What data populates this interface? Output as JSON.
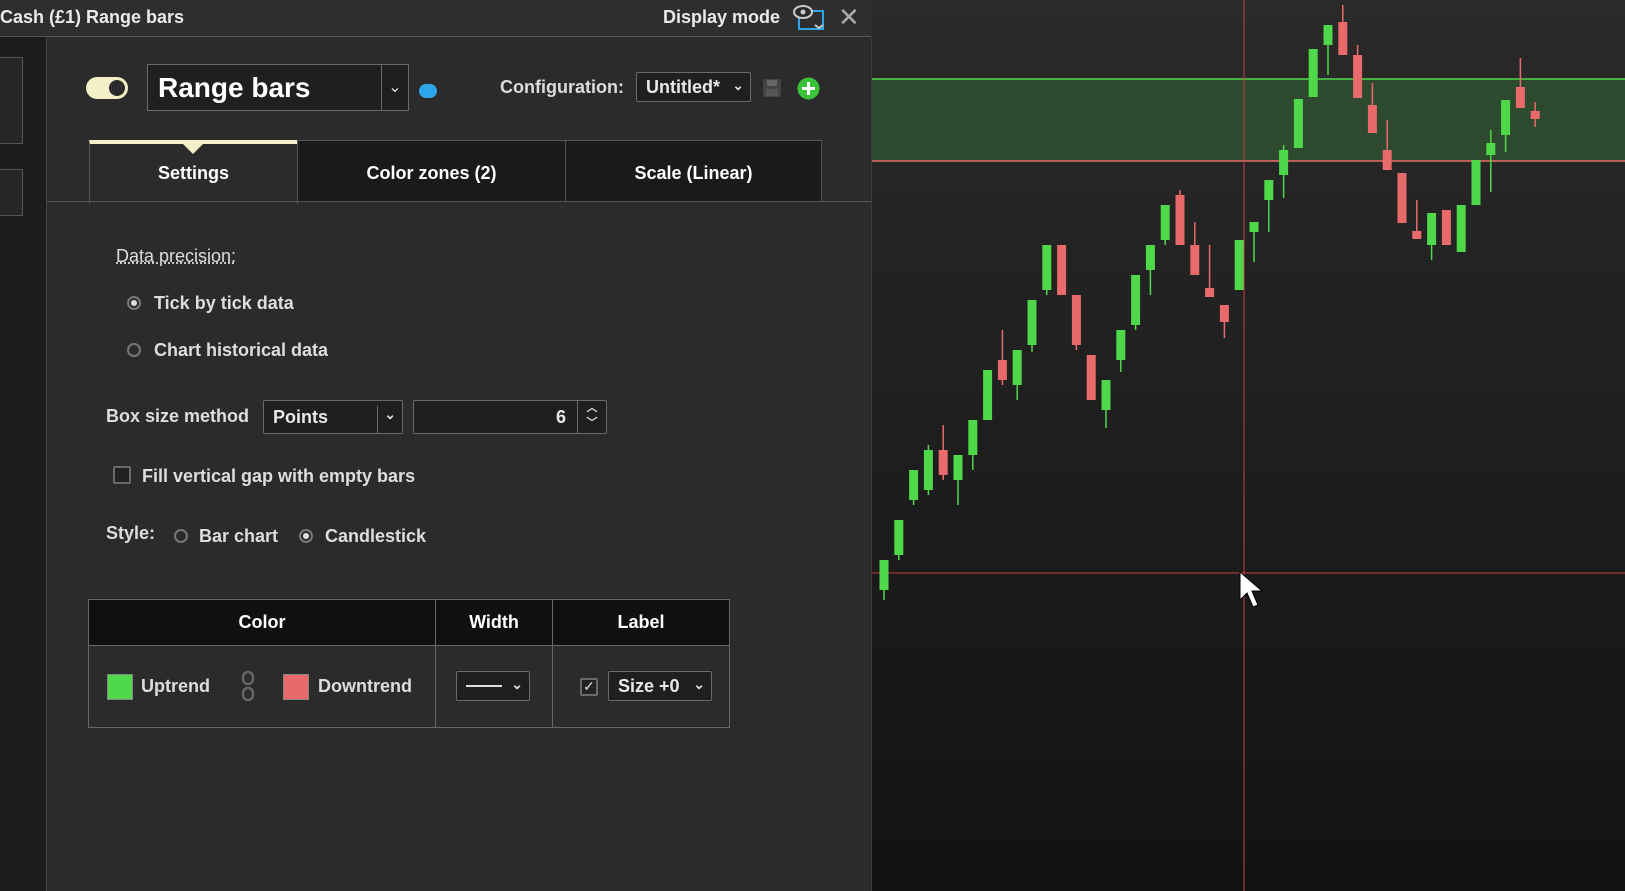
{
  "window": {
    "title": "Cash (£1) Range bars",
    "display_mode_label": "Display mode"
  },
  "indicator": {
    "enabled": true,
    "name": "Range bars"
  },
  "configuration": {
    "label": "Configuration:",
    "value": "Untitled*"
  },
  "tabs": [
    {
      "label": "Settings",
      "active": true
    },
    {
      "label": "Color zones (2)",
      "active": false
    },
    {
      "label": "Scale (Linear)",
      "active": false
    }
  ],
  "settings": {
    "data_precision_label": "Data precision:",
    "precision_options": [
      {
        "label": "Tick by tick data",
        "selected": true
      },
      {
        "label": "Chart historical data",
        "selected": false
      }
    ],
    "box_size_label": "Box size method",
    "box_size_method": "Points",
    "box_size_value": "6",
    "fill_gap_label": "Fill vertical gap with empty bars",
    "fill_gap_checked": false,
    "style_label": "Style:",
    "style_options": [
      {
        "label": "Bar chart",
        "selected": false
      },
      {
        "label": "Candlestick",
        "selected": true
      }
    ]
  },
  "color_table": {
    "headers": [
      "Color",
      "Width",
      "Label"
    ],
    "uptrend_label": "Uptrend",
    "downtrend_label": "Downtrend",
    "uptrend_color": "#4fd84a",
    "downtrend_color": "#e86a6a",
    "label_checked": true,
    "label_size": "Size +0"
  },
  "colors": {
    "accent_toggle": "#f3f0c8",
    "up": "#4fd84a",
    "down": "#e86a6a",
    "zone_fill": "#2e4a2e",
    "crosshair": "#c84040"
  },
  "chart_data": {
    "type": "candlestick",
    "candles": [
      {
        "o": 560,
        "c": 590,
        "h": 560,
        "l": 600,
        "dir": "up"
      },
      {
        "o": 520,
        "c": 555,
        "h": 520,
        "l": 560,
        "dir": "up"
      },
      {
        "o": 470,
        "c": 500,
        "h": 470,
        "l": 505,
        "dir": "up"
      },
      {
        "o": 450,
        "c": 490,
        "h": 445,
        "l": 495,
        "dir": "up"
      },
      {
        "o": 450,
        "c": 475,
        "h": 425,
        "l": 480,
        "dir": "down"
      },
      {
        "o": 455,
        "c": 480,
        "h": 455,
        "l": 505,
        "dir": "up"
      },
      {
        "o": 420,
        "c": 455,
        "h": 420,
        "l": 470,
        "dir": "up"
      },
      {
        "o": 370,
        "c": 420,
        "h": 370,
        "l": 420,
        "dir": "up"
      },
      {
        "o": 360,
        "c": 380,
        "h": 330,
        "l": 385,
        "dir": "down"
      },
      {
        "o": 350,
        "c": 385,
        "h": 350,
        "l": 400,
        "dir": "up"
      },
      {
        "o": 300,
        "c": 345,
        "h": 300,
        "l": 352,
        "dir": "up"
      },
      {
        "o": 245,
        "c": 290,
        "h": 245,
        "l": 295,
        "dir": "up"
      },
      {
        "o": 245,
        "c": 295,
        "h": 245,
        "l": 295,
        "dir": "down"
      },
      {
        "o": 295,
        "c": 345,
        "h": 295,
        "l": 350,
        "dir": "down"
      },
      {
        "o": 355,
        "c": 400,
        "h": 355,
        "l": 400,
        "dir": "down"
      },
      {
        "o": 380,
        "c": 410,
        "h": 380,
        "l": 428,
        "dir": "up"
      },
      {
        "o": 330,
        "c": 360,
        "h": 330,
        "l": 372,
        "dir": "up"
      },
      {
        "o": 275,
        "c": 325,
        "h": 275,
        "l": 330,
        "dir": "up"
      },
      {
        "o": 245,
        "c": 270,
        "h": 245,
        "l": 295,
        "dir": "up"
      },
      {
        "o": 205,
        "c": 240,
        "h": 205,
        "l": 245,
        "dir": "up"
      },
      {
        "o": 195,
        "c": 245,
        "h": 190,
        "l": 245,
        "dir": "down"
      },
      {
        "o": 245,
        "c": 275,
        "h": 222,
        "l": 275,
        "dir": "down"
      },
      {
        "o": 288,
        "c": 297,
        "h": 245,
        "l": 297,
        "dir": "down"
      },
      {
        "o": 305,
        "c": 322,
        "h": 305,
        "l": 338,
        "dir": "down"
      },
      {
        "o": 240,
        "c": 290,
        "h": 240,
        "l": 290,
        "dir": "up"
      },
      {
        "o": 222,
        "c": 232,
        "h": 222,
        "l": 262,
        "dir": "up"
      },
      {
        "o": 180,
        "c": 200,
        "h": 180,
        "l": 232,
        "dir": "up"
      },
      {
        "o": 150,
        "c": 175,
        "h": 145,
        "l": 198,
        "dir": "up"
      },
      {
        "o": 99,
        "c": 148,
        "h": 99,
        "l": 148,
        "dir": "up"
      },
      {
        "o": 49,
        "c": 97,
        "h": 49,
        "l": 97,
        "dir": "up"
      },
      {
        "o": 25,
        "c": 45,
        "h": 25,
        "l": 75,
        "dir": "up"
      },
      {
        "o": 22,
        "c": 55,
        "h": 5,
        "l": 55,
        "dir": "down"
      },
      {
        "o": 55,
        "c": 98,
        "h": 45,
        "l": 98,
        "dir": "down"
      },
      {
        "o": 105,
        "c": 133,
        "h": 83,
        "l": 133,
        "dir": "down"
      },
      {
        "o": 150,
        "c": 170,
        "h": 120,
        "l": 170,
        "dir": "down"
      },
      {
        "o": 173,
        "c": 223,
        "h": 173,
        "l": 223,
        "dir": "down"
      },
      {
        "o": 231,
        "c": 239,
        "h": 200,
        "l": 239,
        "dir": "down"
      },
      {
        "o": 213,
        "c": 245,
        "h": 213,
        "l": 260,
        "dir": "up"
      },
      {
        "o": 210,
        "c": 245,
        "h": 210,
        "l": 245,
        "dir": "down"
      },
      {
        "o": 205,
        "c": 252,
        "h": 205,
        "l": 252,
        "dir": "up"
      },
      {
        "o": 160,
        "c": 205,
        "h": 160,
        "l": 205,
        "dir": "up"
      },
      {
        "o": 143,
        "c": 155,
        "h": 130,
        "l": 192,
        "dir": "up"
      },
      {
        "o": 100,
        "c": 135,
        "h": 100,
        "l": 152,
        "dir": "up"
      },
      {
        "o": 87,
        "c": 108,
        "h": 58,
        "l": 108,
        "dir": "down"
      },
      {
        "o": 111,
        "c": 119,
        "h": 102,
        "l": 127,
        "dir": "down"
      }
    ]
  }
}
